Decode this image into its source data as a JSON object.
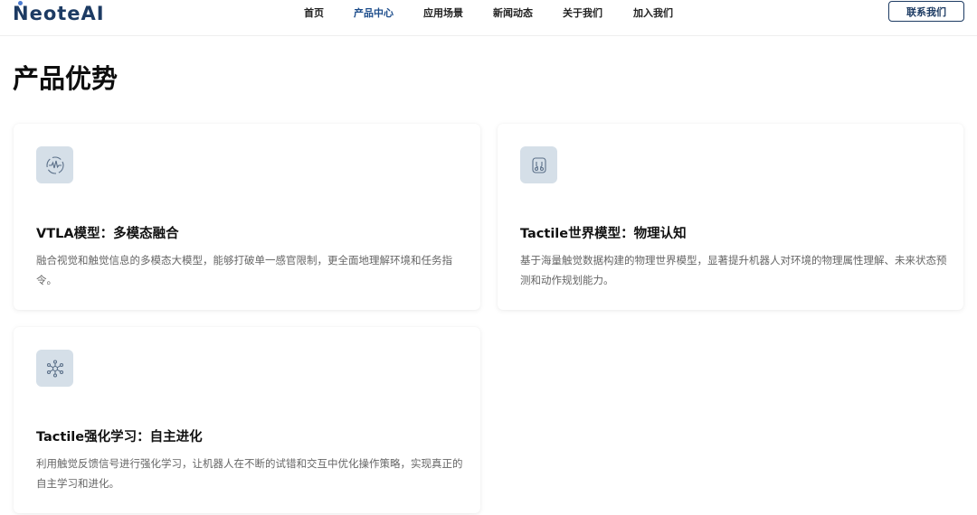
{
  "header": {
    "logo": "NeoteAI",
    "nav": [
      {
        "label": "首页",
        "active": false
      },
      {
        "label": "产品中心",
        "active": true
      },
      {
        "label": "应用场景",
        "active": false
      },
      {
        "label": "新闻动态",
        "active": false
      },
      {
        "label": "关于我们",
        "active": false
      },
      {
        "label": "加入我们",
        "active": false
      }
    ],
    "contact_label": "联系我们"
  },
  "page_title": "产品优势",
  "cards": [
    {
      "icon": "waveform-circle-icon",
      "title": "VTLA模型：多模态融合",
      "description": "融合视觉和触觉信息的多模态大模型，能够打破单一感官限制，更全面地理解环境和任务指令。"
    },
    {
      "icon": "robot-hands-icon",
      "title": "Tactile世界模型：物理认知",
      "description": "基于海量触觉数据构建的物理世界模型，显著提升机器人对环境的物理属性理解、未来状态预测和动作规划能力。"
    },
    {
      "icon": "network-nodes-icon",
      "title": "Tactile强化学习：自主进化",
      "description": "利用触觉反馈信号进行强化学习，让机器人在不断的试错和交互中优化操作策略，实现真正的自主学习和进化。"
    }
  ],
  "colors": {
    "brand": "#1d3b63",
    "nav_active": "#1e4e8c",
    "icon_bg": "#d5dfe8",
    "text_muted": "#666666"
  }
}
